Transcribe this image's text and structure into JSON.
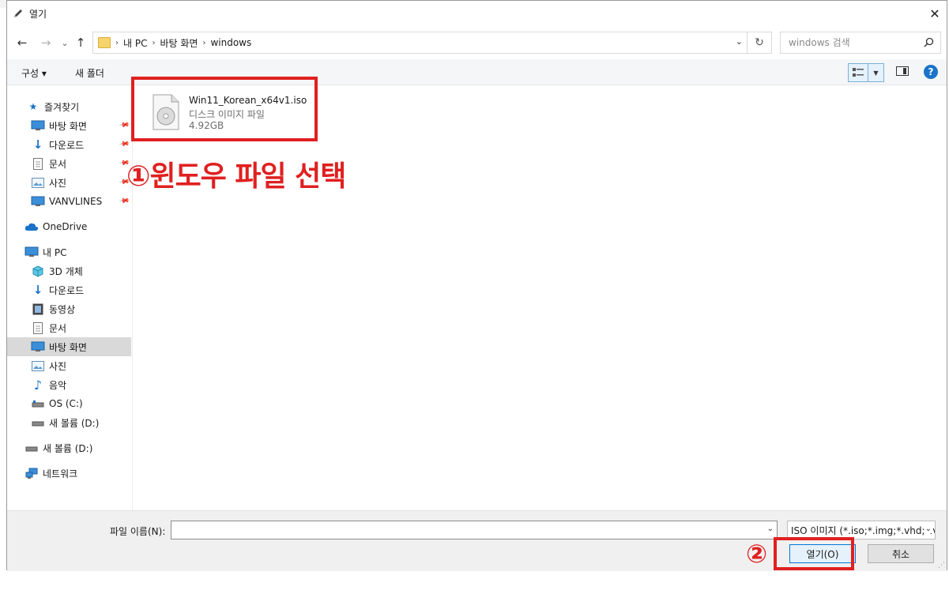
{
  "window": {
    "title": "열기",
    "close": "✕"
  },
  "nav": {
    "back": "←",
    "forward": "→",
    "recent": "⌄",
    "up": "↑"
  },
  "address": {
    "crumbs": [
      "내 PC",
      "바탕 화면",
      "windows"
    ],
    "separator": "›",
    "dropdown": "⌄",
    "refresh": "↻"
  },
  "search": {
    "placeholder": "windows 검색",
    "icon": "search-icon"
  },
  "toolbar": {
    "organize": "구성 ▾",
    "new_folder": "새 폴더",
    "help": "?"
  },
  "sidebar": {
    "quick_access": "즐겨찾기",
    "items": [
      {
        "label": "바탕 화면",
        "icon": "desktop-icon",
        "pinned": true
      },
      {
        "label": "다운로드",
        "icon": "download-icon",
        "pinned": true
      },
      {
        "label": "문서",
        "icon": "document-icon",
        "pinned": true
      },
      {
        "label": "사진",
        "icon": "picture-icon",
        "pinned": true
      },
      {
        "label": "VANVLINES",
        "icon": "monitor-icon",
        "pinned": true
      },
      {
        "label": "OneDrive",
        "icon": "cloud-icon"
      },
      {
        "label": "내 PC",
        "icon": "pc-icon"
      },
      {
        "label": "3D 개체",
        "icon": "cube-icon"
      },
      {
        "label": "다운로드",
        "icon": "download-icon"
      },
      {
        "label": "동영상",
        "icon": "video-icon"
      },
      {
        "label": "문서",
        "icon": "document-icon"
      },
      {
        "label": "바탕 화면",
        "icon": "desktop-icon",
        "selected": true
      },
      {
        "label": "사진",
        "icon": "picture-icon"
      },
      {
        "label": "음악",
        "icon": "music-icon"
      },
      {
        "label": "OS (C:)",
        "icon": "drive-icon"
      },
      {
        "label": "새 볼륨 (D:)",
        "icon": "drive-icon"
      },
      {
        "label": "새 볼륨 (D:)",
        "icon": "drive-icon"
      },
      {
        "label": "네트워크",
        "icon": "network-icon"
      }
    ]
  },
  "file": {
    "name": "Win11_Korean_x64v1.iso",
    "type": "디스크 이미지 파일",
    "size": "4.92GB"
  },
  "annotations": {
    "step1": "①윈도우 파일 선택",
    "step2": "②"
  },
  "bottom": {
    "filename_label": "파일 이름(N):",
    "filename_value": "",
    "filter": "ISO 이미지 (*.iso;*.img;*.vhd;*.vhdx)",
    "open_button": "열기(O)",
    "cancel_button": "취소"
  },
  "colors": {
    "annotation_red": "#e02020",
    "selected_bg": "#d9d9d9",
    "accent": "#0078d7"
  }
}
